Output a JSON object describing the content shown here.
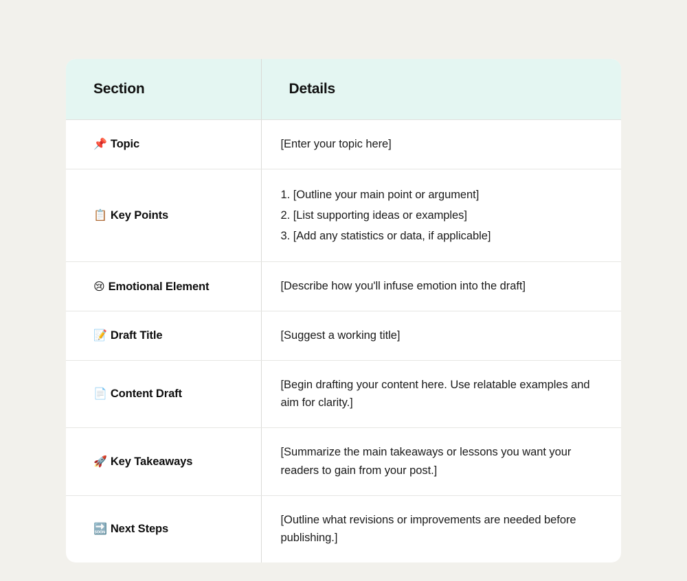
{
  "canvas": {
    "background_color": "#f2f1ec",
    "card_background_color": "#ffffff",
    "header_background_color": "#e4f6f2",
    "border_color": "#e0e0dd",
    "text_color": "#1a1a1a"
  },
  "table": {
    "columns": [
      {
        "key": "section",
        "label": "Section"
      },
      {
        "key": "details",
        "label": "Details"
      }
    ],
    "rows": [
      {
        "emoji": "📌",
        "emoji_name": "pushpin-emoji",
        "section": "Topic",
        "details_kind": "text",
        "details": "[Enter your topic here]"
      },
      {
        "emoji": "📋",
        "emoji_name": "clipboard-emoji",
        "section": "Key Points",
        "details_kind": "list",
        "details_items": [
          "1. [Outline your main point or argument]",
          "2. [List supporting ideas or examples]",
          "3. [Add any statistics or data, if applicable]"
        ]
      },
      {
        "emoji": "😢",
        "emoji_name": "crying-face-emoji",
        "section": "Emotional Element",
        "details_kind": "text",
        "details": "[Describe how you'll infuse emotion into the draft]"
      },
      {
        "emoji": "📝",
        "emoji_name": "memo-emoji",
        "section": "Draft Title",
        "details_kind": "text",
        "details": "[Suggest a working title]"
      },
      {
        "emoji": "📄",
        "emoji_name": "page-facing-up-emoji",
        "section": "Content Draft",
        "details_kind": "text",
        "details": "[Begin drafting your content here. Use relatable examples and aim for clarity.]"
      },
      {
        "emoji": "🚀",
        "emoji_name": "rocket-emoji",
        "section": "Key Takeaways",
        "details_kind": "text",
        "details": "[Summarize the main takeaways or lessons you want your readers to gain from your post.]"
      },
      {
        "emoji": "🔜",
        "emoji_name": "soon-arrow-emoji",
        "section": "Next Steps",
        "details_kind": "text",
        "details": "[Outline what revisions or improvements are needed before publishing.]"
      }
    ]
  }
}
